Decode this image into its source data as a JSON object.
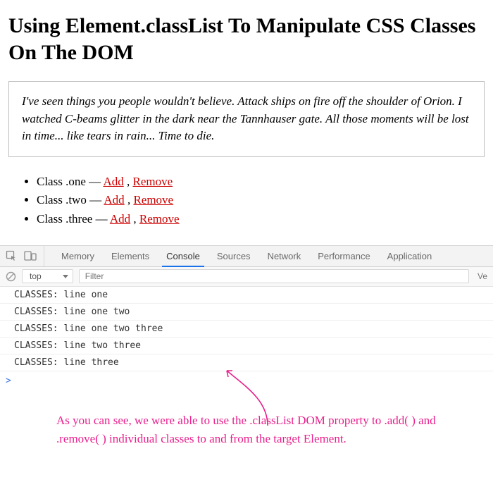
{
  "page": {
    "title": "Using Element.classList To Manipulate CSS Classes On The DOM",
    "quote": "I've seen things you people wouldn't believe. Attack ships on fire off the shoulder of Orion. I watched C-beams glitter in the dark near the Tannhauser gate. All those moments will be lost in time... like tears in rain... Time to die."
  },
  "class_list": {
    "items": [
      {
        "label": "Class .one",
        "add": "Add",
        "remove": "Remove"
      },
      {
        "label": "Class .two",
        "add": "Add",
        "remove": "Remove"
      },
      {
        "label": "Class .three",
        "add": "Add",
        "remove": "Remove"
      }
    ],
    "separator_dash": " — ",
    "separator_comma": " , "
  },
  "devtools": {
    "tabs": {
      "memory": "Memory",
      "elements": "Elements",
      "console": "Console",
      "sources": "Sources",
      "network": "Network",
      "performance": "Performance",
      "application": "Application"
    },
    "active_tab": "console",
    "filterbar": {
      "context": "top",
      "filter_placeholder": "Filter",
      "verbose": "Ve"
    },
    "console_lines": [
      "CLASSES: line one",
      "CLASSES: line one two",
      "CLASSES: line one two three",
      "CLASSES: line two three",
      "CLASSES: line three"
    ],
    "prompt": ">"
  },
  "annotation": {
    "text": "As you can see, we were able to use the .classList DOM property to .add( ) and .remove( ) individual classes to and from the target Element."
  }
}
